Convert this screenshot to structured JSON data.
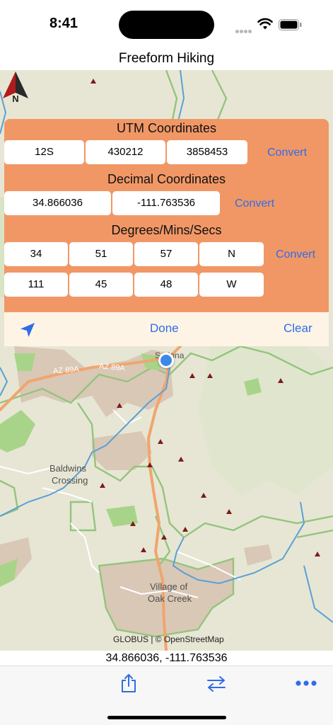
{
  "status_bar": {
    "time": "8:41"
  },
  "nav": {
    "title": "Freeform Hiking"
  },
  "colors": {
    "accent": "#2f6de6",
    "panel": "#f19766",
    "toolbar": "#fdf4e6",
    "location": "#3a88e8"
  },
  "panel": {
    "utm": {
      "title": "UTM Coordinates",
      "zone": "12S",
      "easting": "430212",
      "northing": "3858453",
      "convert_label": "Convert"
    },
    "decimal": {
      "title": "Decimal Coordinates",
      "latitude": "34.866036",
      "longitude": "-111.763536",
      "convert_label": "Convert"
    },
    "dms": {
      "title": "Degrees/Mins/Secs",
      "lat": {
        "deg": "34",
        "min": "51",
        "sec": "57",
        "hemi": "N"
      },
      "lon": {
        "deg": "111",
        "min": "45",
        "sec": "48",
        "hemi": "W"
      },
      "convert_label": "Convert"
    },
    "toolbar": {
      "locate_icon": "location-arrow-icon",
      "done_label": "Done",
      "clear_label": "Clear"
    }
  },
  "map": {
    "labels": {
      "sedona": "Sedona",
      "az89a_1": "AZ 89A",
      "az89a_2": "AZ 89A",
      "baldwins": "Baldwins",
      "crossing": "Crossing",
      "village": "Village of",
      "oak_creek": "Oak Creek"
    },
    "compass_label": "N",
    "attribution": "GLOBUS | © OpenStreetMap"
  },
  "coord_readout": "34.866036, -111.763536",
  "tab_bar": {
    "icons": [
      "share-icon",
      "swap-arrows-icon",
      "more-icon"
    ]
  }
}
